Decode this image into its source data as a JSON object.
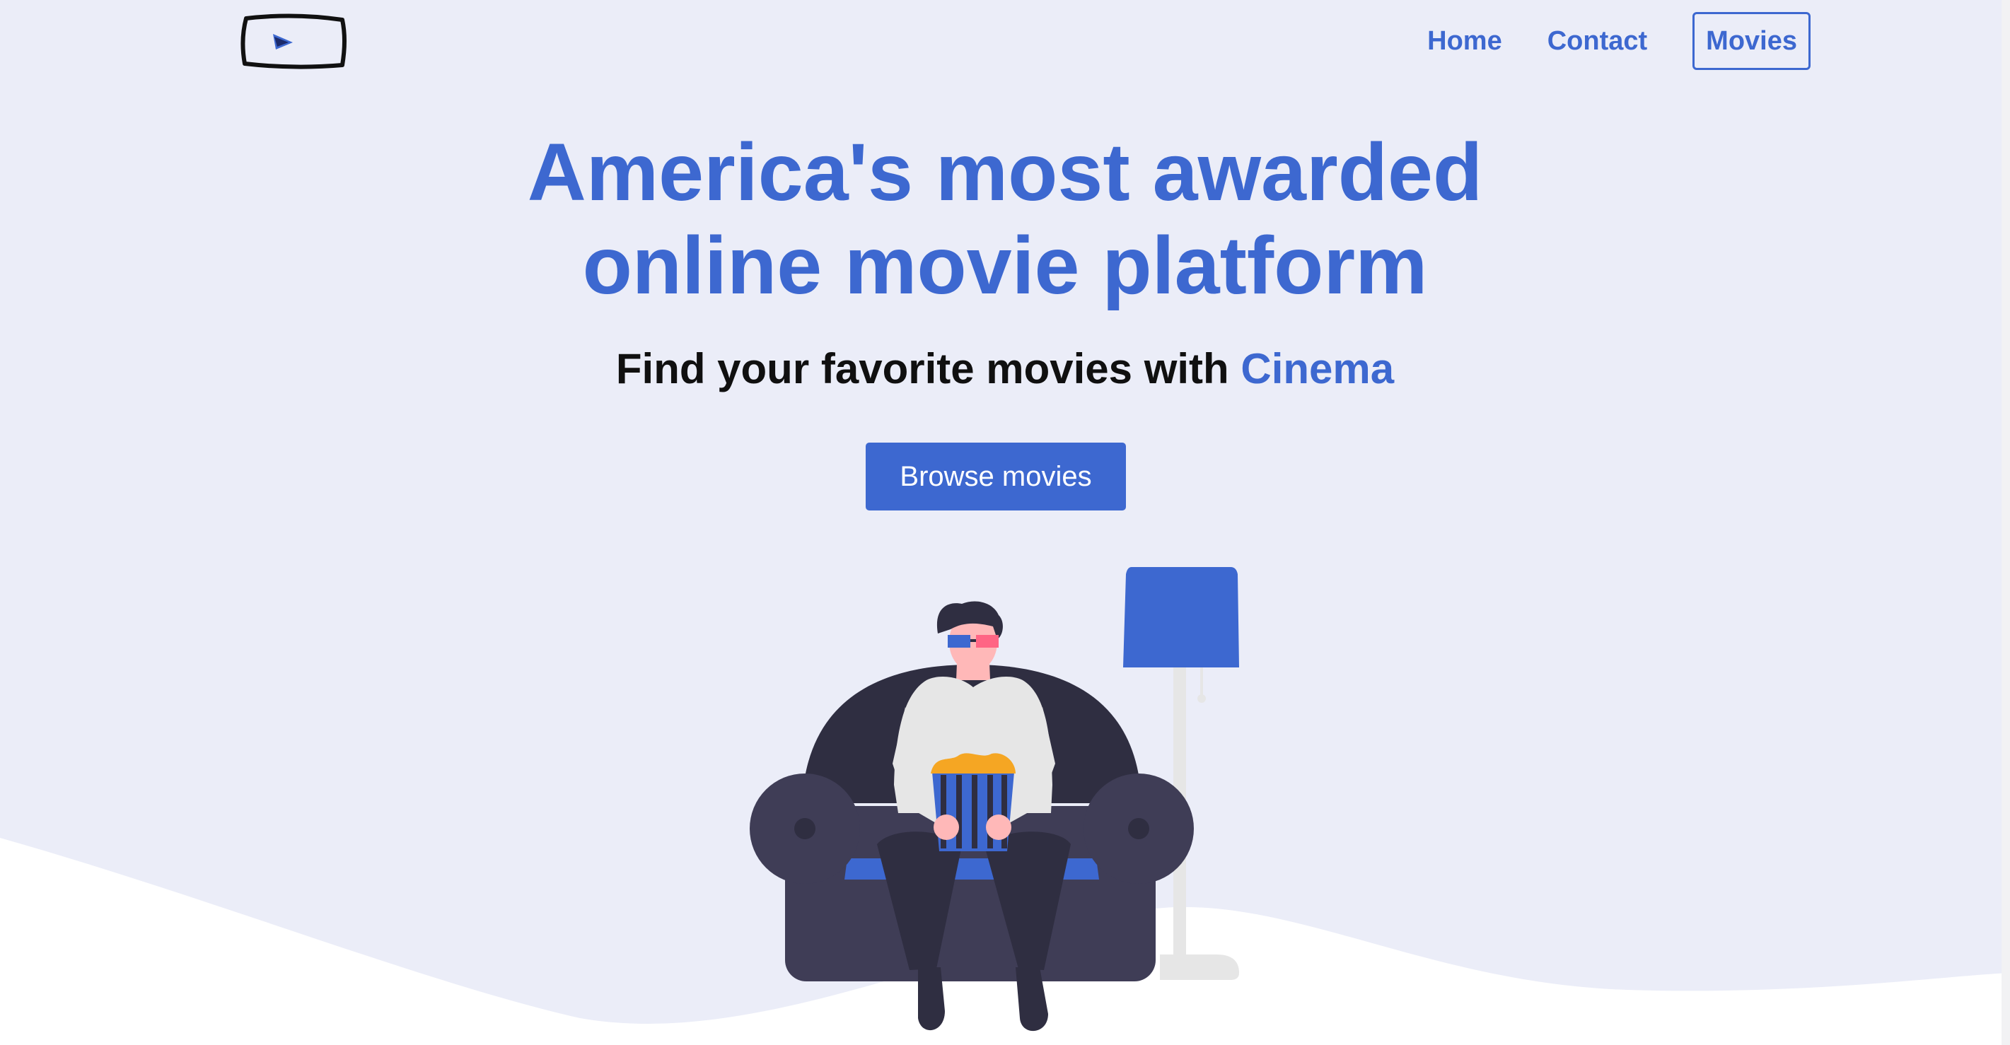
{
  "nav": {
    "logo_icon": "film-player-logo-icon",
    "items": [
      {
        "label": "Home"
      },
      {
        "label": "Contact"
      },
      {
        "label": "Movies",
        "active": true
      }
    ]
  },
  "hero": {
    "title_line1": "America's most awarded",
    "title_line2": "online movie platform",
    "subtitle_prefix": "Find your favorite movies with ",
    "subtitle_brand": "Cinema",
    "cta_label": "Browse movies"
  },
  "illustration": "person-on-armchair-with-popcorn",
  "colors": {
    "accent": "#3d68d0",
    "background": "#ebedf8",
    "armchair": "#3f3d56",
    "text_dark": "#101010"
  }
}
